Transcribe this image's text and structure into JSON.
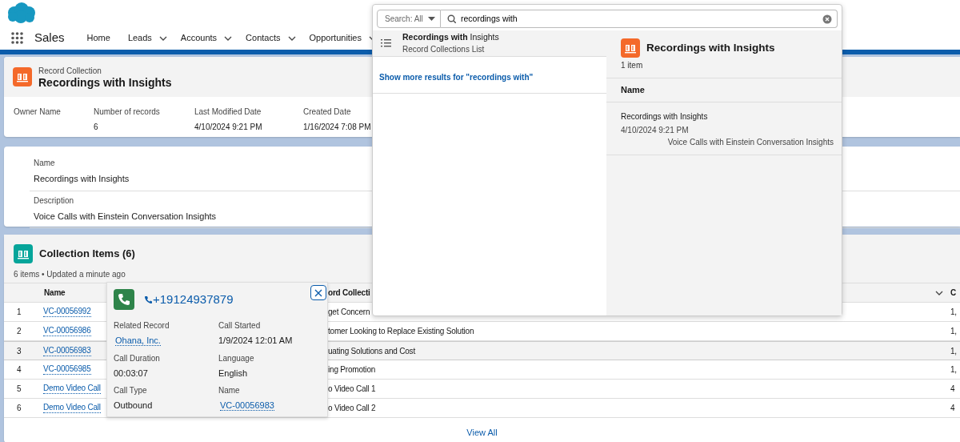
{
  "app_header": {
    "app_name": "Sales",
    "nav_items": [
      {
        "label": "Home",
        "has_menu": false
      },
      {
        "label": "Leads",
        "has_menu": true
      },
      {
        "label": "Accounts",
        "has_menu": true
      },
      {
        "label": "Contacts",
        "has_menu": true
      },
      {
        "label": "Opportunities",
        "has_menu": true
      }
    ]
  },
  "record_header": {
    "object_type": "Record Collection",
    "title": "Recordings with Insights",
    "fields": [
      {
        "label": "Owner Name"
      },
      {
        "label": "Number of records",
        "value": "6"
      },
      {
        "label": "Last Modified Date",
        "value": "4/10/2024 9:21 PM"
      },
      {
        "label": "Created Date",
        "value": "1/16/2024 7:08 PM"
      }
    ]
  },
  "details": [
    {
      "label": "Name",
      "value": "Recordings with Insights"
    },
    {
      "label": "Description",
      "value": "Voice Calls with Einstein Conversation Insights"
    }
  ],
  "related_list": {
    "title": "Collection Items (6)",
    "subtitle": "6 items • Updated a minute ago",
    "columns": [
      {
        "label": "Name",
        "has_menu": false
      },
      {
        "label": "ord Collecti",
        "has_menu": true
      },
      {
        "label": "C",
        "has_menu": false
      }
    ],
    "rows": [
      {
        "number": "1",
        "name": "VC-00056992",
        "column_2": "get Concern",
        "column_3": "1,",
        "selected": false
      },
      {
        "number": "2",
        "name": "VC-00056986",
        "column_2": "tomer Looking to Replace Existing Solution",
        "column_3": "1,",
        "selected": false
      },
      {
        "number": "3",
        "name": "VC-00056983",
        "column_2": "uating Solutions and Cost",
        "column_3": "1,",
        "selected": true
      },
      {
        "number": "4",
        "name": "VC-00056985",
        "column_2": "ing Promotion",
        "column_3": "1,",
        "selected": false
      },
      {
        "number": "5",
        "name": "Demo Video Call",
        "column_2": "o Video Call 1",
        "column_3": "4",
        "selected": false
      },
      {
        "number": "6",
        "name": "Demo Video Call",
        "column_2": "o Video Call 2",
        "column_3": "4",
        "selected": false
      }
    ],
    "view_all": "View All"
  },
  "hover_card": {
    "phone": "+19124937879",
    "fields": [
      {
        "label": "Related Record",
        "value": "Ohana, Inc.",
        "link": true
      },
      {
        "label": "Call Started",
        "value": "1/9/2024 12:01 AM",
        "link": false
      },
      {
        "label": "Call Duration",
        "value": "00:03:07",
        "link": false
      },
      {
        "label": "Language",
        "value": "English",
        "link": false
      },
      {
        "label": "Call Type",
        "value": "Outbound",
        "link": false
      },
      {
        "label": "Name",
        "value": "VC-00056983",
        "link": true
      }
    ]
  },
  "search": {
    "scope": "Search: All",
    "query": "recordings with",
    "results": [
      {
        "title": "**Recordings with** Insights",
        "subtitle": "Record Collections List",
        "selected": true
      }
    ],
    "show_more": "Show more results for \"recordings with\"",
    "preview": {
      "title": "Recordings with Insights",
      "count": "1 item",
      "column": "Name",
      "items": [
        {
          "name": "Recordings with Insights",
          "date": "4/10/2024 9:21 PM",
          "description": "Voice Calls with Einstein Conversation Insights"
        }
      ]
    }
  }
}
